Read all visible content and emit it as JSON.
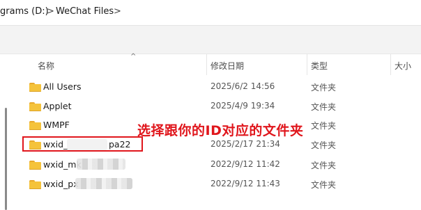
{
  "breadcrumb": {
    "drive": "grams (D:)",
    "separator": ">",
    "folder": "WeChat Files"
  },
  "columns": {
    "name": "名称",
    "date": "修改日期",
    "type": "类型",
    "size": "大小"
  },
  "files": [
    {
      "name": "All Users",
      "date": "2025/6/2 14:56",
      "type": "文件夹"
    },
    {
      "name": "Applet",
      "date": "2025/4/9 19:34",
      "type": "文件夹"
    },
    {
      "name": "WMPF",
      "date": "",
      "type": "文件夹"
    },
    {
      "name_prefix": "wxid_",
      "name_suffix": "pa22",
      "date": "2025/2/17 21:34",
      "type": "文件夹"
    },
    {
      "name_prefix": "wxid_mk",
      "date": "2022/9/12 11:42",
      "type": "文件夹"
    },
    {
      "name_prefix": "wxid_px",
      "date": "2022/9/12 11:43",
      "type": "文件夹"
    }
  ],
  "annotation": "选择跟你的ID对应的文件夹",
  "colors": {
    "annotation": "#e0161c",
    "folder": "#f5c33b"
  }
}
